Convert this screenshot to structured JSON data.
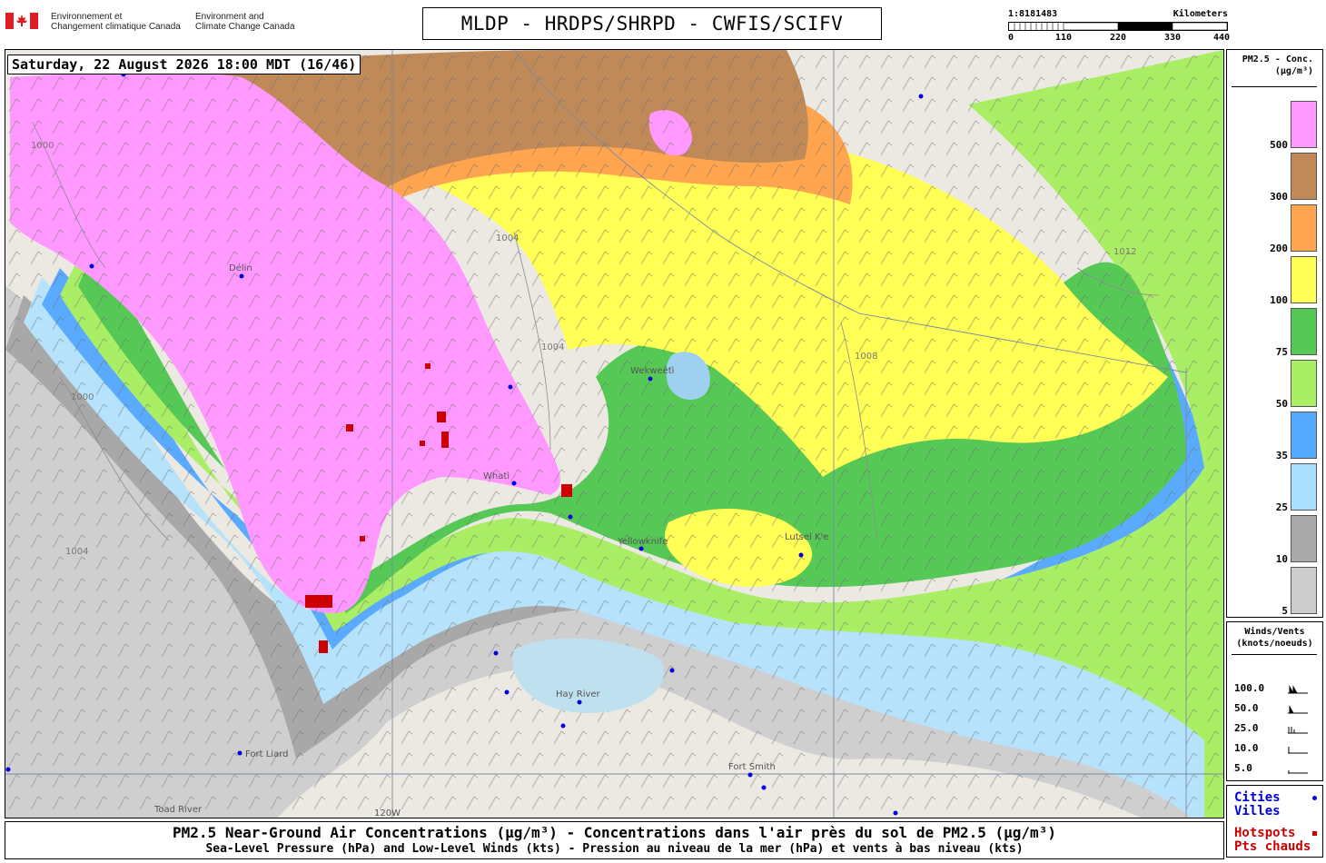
{
  "header": {
    "dept_fr_line1": "Environnement et",
    "dept_fr_line2": "Changement climatique Canada",
    "dept_en_line1": "Environment and",
    "dept_en_line2": "Climate Change Canada",
    "title": "MLDP - HRDPS/SHRPD - CWFIS/SCIFV"
  },
  "scale_bar": {
    "ratio": "1:8181483",
    "unit": "Kilometers",
    "ticks": [
      "0",
      "110",
      "220",
      "330",
      "440"
    ]
  },
  "map": {
    "time_label": "Saturday, 22 August 2026 18:00 MDT (16/46)",
    "places": [
      "Délin",
      "Wekweètì",
      "Whatì",
      "Yellowknife",
      "Lutsel K'e",
      "Hay River",
      "Fort Liard",
      "Fort Smith",
      "Toad River"
    ],
    "longitude_label": "120W",
    "isobars": [
      "1000",
      "1004",
      "1008",
      "1012"
    ]
  },
  "legend_pm": {
    "title_line1": "PM2.5 - Conc.",
    "title_line2": "(µg/m³)",
    "bins": [
      {
        "label": "500",
        "color": "#ff99ff"
      },
      {
        "label": "300",
        "color": "#c08a58"
      },
      {
        "label": "200",
        "color": "#ffa54f"
      },
      {
        "label": "100",
        "color": "#ffff55"
      },
      {
        "label": "75",
        "color": "#55c855"
      },
      {
        "label": "50",
        "color": "#aaee66"
      },
      {
        "label": "35",
        "color": "#55aaff"
      },
      {
        "label": "25",
        "color": "#aae0ff"
      },
      {
        "label": "10",
        "color": "#aaaaaa"
      },
      {
        "label": "5",
        "color": "#cccccc"
      }
    ]
  },
  "legend_wind": {
    "title_line1": "Winds/Vents",
    "title_line2": "(knots/noeuds)",
    "rows": [
      "100.0",
      "50.0",
      "25.0",
      "10.0",
      "5.0"
    ]
  },
  "legend_key": {
    "cities_en": "Cities",
    "cities_fr": "Villes",
    "hotspots_en": "Hotspots",
    "hotspots_fr": "Pts chauds",
    "city_color": "#0000dd",
    "hotspot_color": "#cc0000"
  },
  "caption": {
    "line1": "PM2.5 Near-Ground Air Concentrations (µg/m³) - Concentrations dans l'air près du sol de PM2.5 (µg/m³)",
    "line2": "Sea-Level Pressure (hPa) and Low-Level Winds (kts) - Pression au niveau de la mer (hPa) et vents à bas niveau (kts)"
  }
}
